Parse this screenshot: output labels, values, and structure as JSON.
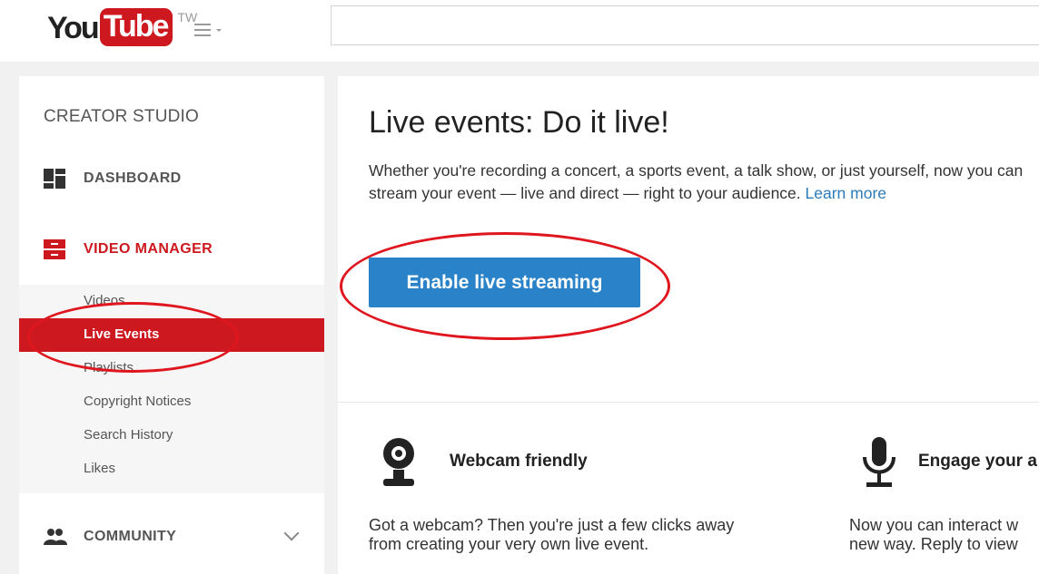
{
  "header": {
    "logo_you": "You",
    "logo_tube": "Tube",
    "region": "TW",
    "search_placeholder": ""
  },
  "sidebar": {
    "title": "CREATOR STUDIO",
    "dashboard": {
      "label": "DASHBOARD",
      "icon": "dashboard-icon"
    },
    "video_manager": {
      "label": "VIDEO MANAGER",
      "icon": "video-manager-icon"
    },
    "subitems": [
      {
        "label": "Videos"
      },
      {
        "label": "Live Events",
        "selected": true
      },
      {
        "label": "Playlists"
      },
      {
        "label": "Copyright Notices"
      },
      {
        "label": "Search History"
      },
      {
        "label": "Likes"
      }
    ],
    "community": {
      "label": "COMMUNITY",
      "icon": "community-icon"
    }
  },
  "main": {
    "title": "Live events: Do it live!",
    "description": "Whether you're recording a concert, a sports event, a talk show, or just yourself, now you can stream your event — live and direct — right to your audience.",
    "learn_more": "Learn more",
    "enable_button": "Enable live streaming",
    "features": [
      {
        "icon": "webcam-icon",
        "title": "Webcam friendly",
        "line1": "Got a webcam? Then you're just a few clicks away",
        "line2": "from creating your very own live event."
      },
      {
        "icon": "microphone-icon",
        "title": "Engage your a",
        "line1": "Now you can interact w",
        "line2": "new way. Reply to view"
      }
    ]
  },
  "colors": {
    "brand_red": "#cc181e",
    "button_blue": "#2a82c8",
    "annotation_red": "#e0161e",
    "link_blue": "#2b7bb9"
  }
}
